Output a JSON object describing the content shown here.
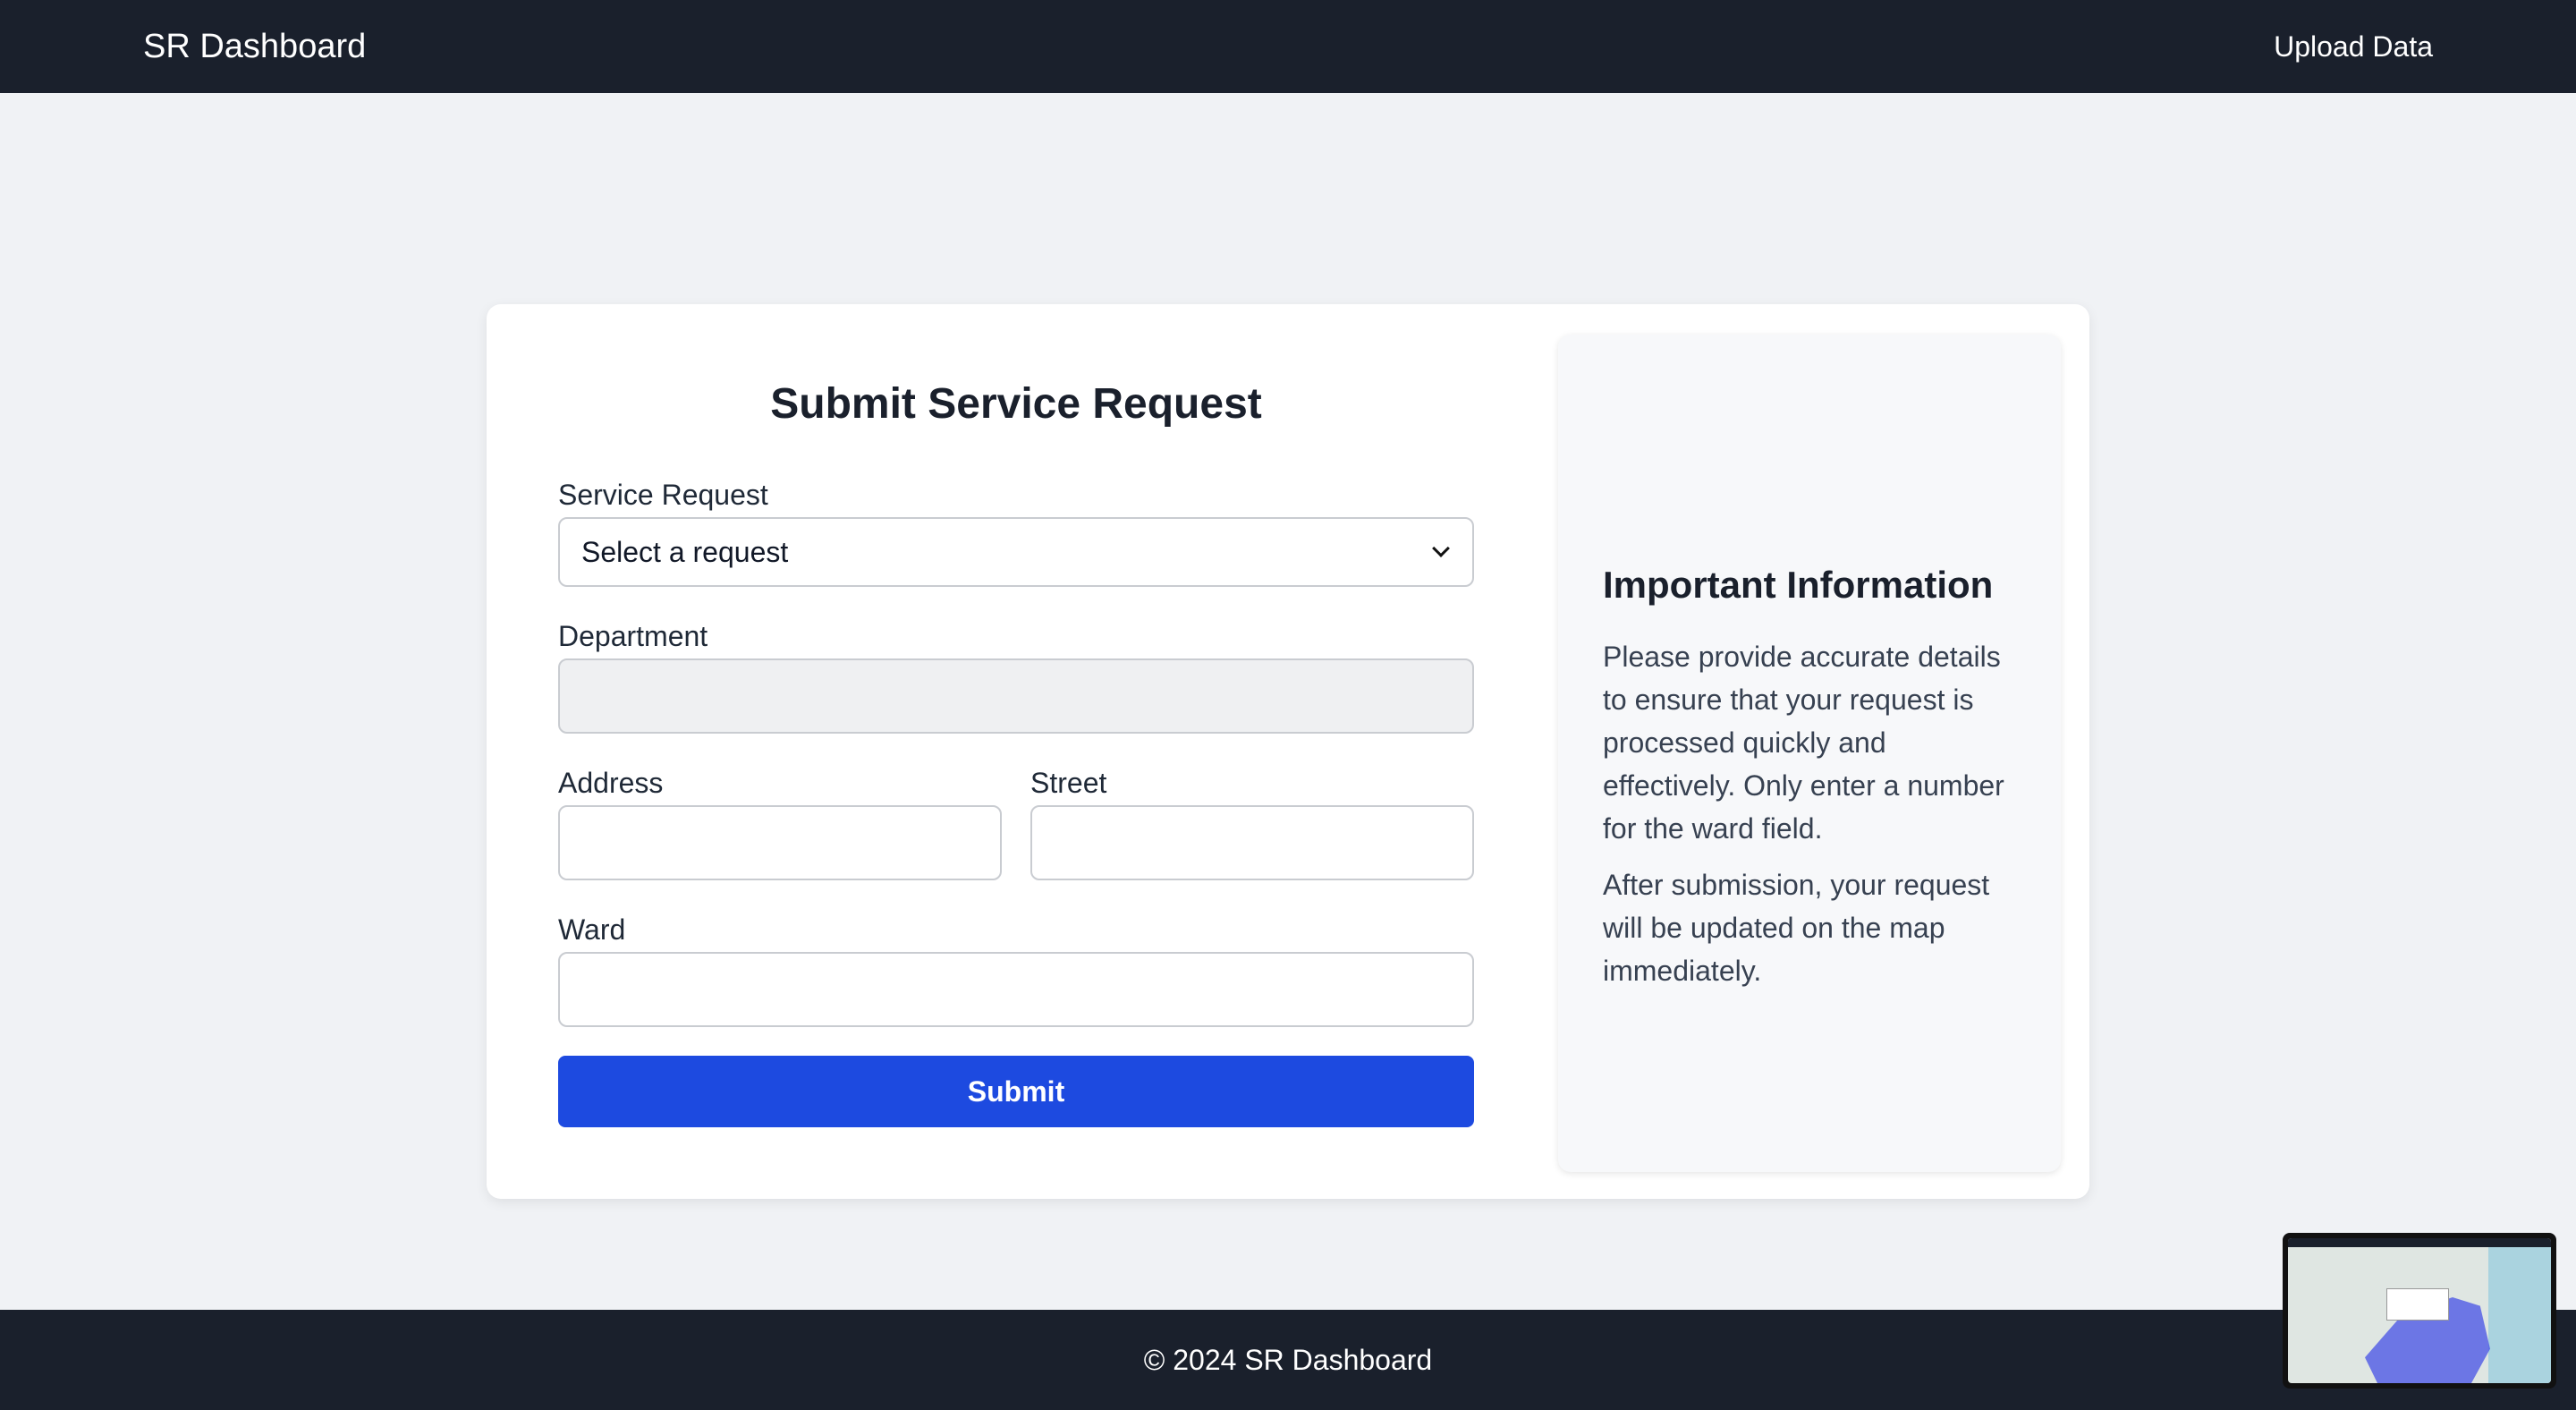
{
  "navbar": {
    "brand": "SR Dashboard",
    "upload_link": "Upload Data"
  },
  "form": {
    "title": "Submit Service Request",
    "service_request_label": "Service Request",
    "service_request_value": "Select a request",
    "department_label": "Department",
    "department_value": "",
    "address_label": "Address",
    "address_value": "",
    "street_label": "Street",
    "street_value": "",
    "ward_label": "Ward",
    "ward_value": "",
    "submit_label": "Submit"
  },
  "info_panel": {
    "title": "Important Information",
    "paragraph_1": "Please provide accurate details to ensure that your request is processed quickly and effectively. Only enter a number for the ward field.",
    "paragraph_2": "After submission, your request will be updated on the map immediately."
  },
  "footer": {
    "text": "© 2024 SR Dashboard"
  },
  "colors": {
    "navbar_bg": "#1a202c",
    "page_bg": "#f0f2f5",
    "primary_button": "#1d4ae0"
  },
  "icons": {
    "select_chevron": "chevron-down-icon"
  }
}
